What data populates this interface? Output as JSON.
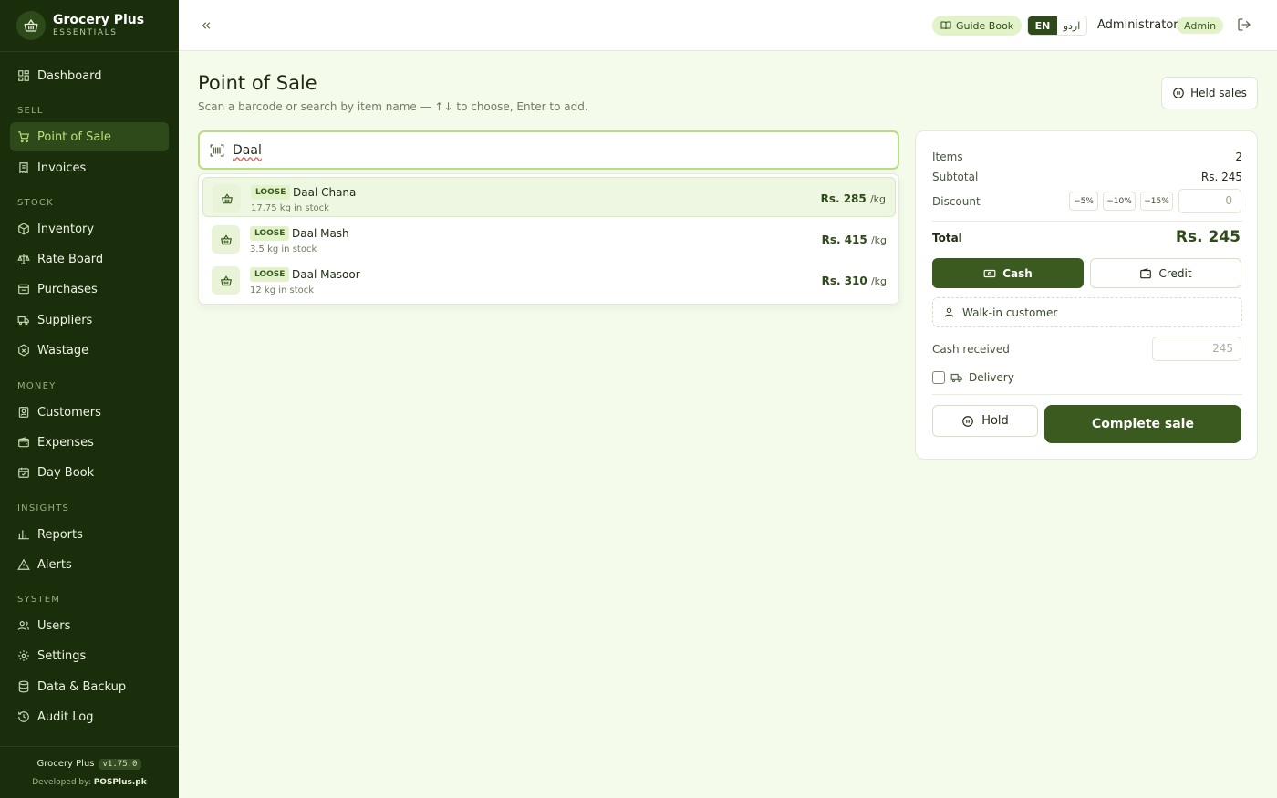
{
  "brand": {
    "name": "Grocery Plus",
    "subtitle": "ESSENTIALS"
  },
  "sidebar": {
    "items": [
      {
        "label": "Dashboard",
        "icon": "dashboard-icon"
      },
      {
        "label": "Point of Sale",
        "icon": "cart-icon",
        "active": true
      },
      {
        "label": "Invoices",
        "icon": "receipt-icon"
      },
      {
        "label": "Inventory",
        "icon": "box-icon"
      },
      {
        "label": "Rate Board",
        "icon": "scale-icon"
      },
      {
        "label": "Purchases",
        "icon": "purchases-icon"
      },
      {
        "label": "Suppliers",
        "icon": "truck-icon"
      },
      {
        "label": "Wastage",
        "icon": "wastage-icon"
      },
      {
        "label": "Customers",
        "icon": "contact-icon"
      },
      {
        "label": "Expenses",
        "icon": "wallet-icon"
      },
      {
        "label": "Day Book",
        "icon": "calendar-icon"
      },
      {
        "label": "Reports",
        "icon": "bar-chart-icon"
      },
      {
        "label": "Alerts",
        "icon": "alert-icon"
      },
      {
        "label": "Users",
        "icon": "users-icon"
      },
      {
        "label": "Settings",
        "icon": "gear-icon"
      },
      {
        "label": "Data & Backup",
        "icon": "database-icon"
      },
      {
        "label": "Audit Log",
        "icon": "history-icon"
      }
    ],
    "sections": [
      "SELL",
      "STOCK",
      "MONEY",
      "INSIGHTS",
      "SYSTEM"
    ],
    "footer": {
      "app": "Grocery Plus",
      "version": "v1.75.0",
      "developed_prefix": "Developed by:",
      "developer": "POSPlus.pk"
    }
  },
  "topbar": {
    "guide": "Guide Book",
    "lang_en": "EN",
    "lang_ur": "اردو",
    "user": "Administrator",
    "role": "Admin"
  },
  "page": {
    "title": "Point of Sale",
    "subtitle": "Scan a barcode or search by item name — ↑↓ to choose, Enter to add.",
    "held_sales": "Held sales"
  },
  "search": {
    "value": "Daal"
  },
  "results": [
    {
      "badge": "LOOSE",
      "name": "Daal Chana",
      "stock": "17.75 kg in stock",
      "price": "Rs. 285",
      "unit": "/kg",
      "selected": true
    },
    {
      "badge": "LOOSE",
      "name": "Daal Mash",
      "stock": "3.5 kg in stock",
      "price": "Rs. 415",
      "unit": "/kg"
    },
    {
      "badge": "LOOSE",
      "name": "Daal Masoor",
      "stock": "12 kg in stock",
      "price": "Rs. 310",
      "unit": "/kg"
    }
  ],
  "cart": {
    "items_label": "Items",
    "items_value": "2",
    "subtotal_label": "Subtotal",
    "subtotal_value": "Rs. 245",
    "discount_label": "Discount",
    "discount_options": [
      "−5%",
      "−10%",
      "−15%"
    ],
    "discount_placeholder": "0",
    "total_label": "Total",
    "total_value": "Rs. 245",
    "cash": "Cash",
    "credit": "Credit",
    "customer": "Walk-in customer",
    "cash_received_label": "Cash received",
    "cash_received_placeholder": "245",
    "delivery": "Delivery",
    "hold": "Hold",
    "complete": "Complete sale"
  },
  "colors": {
    "sidebar": "#1a2e0b",
    "accent": "#3a5a1f",
    "active_text": "#b9e07a",
    "background": "#f4fbea"
  }
}
